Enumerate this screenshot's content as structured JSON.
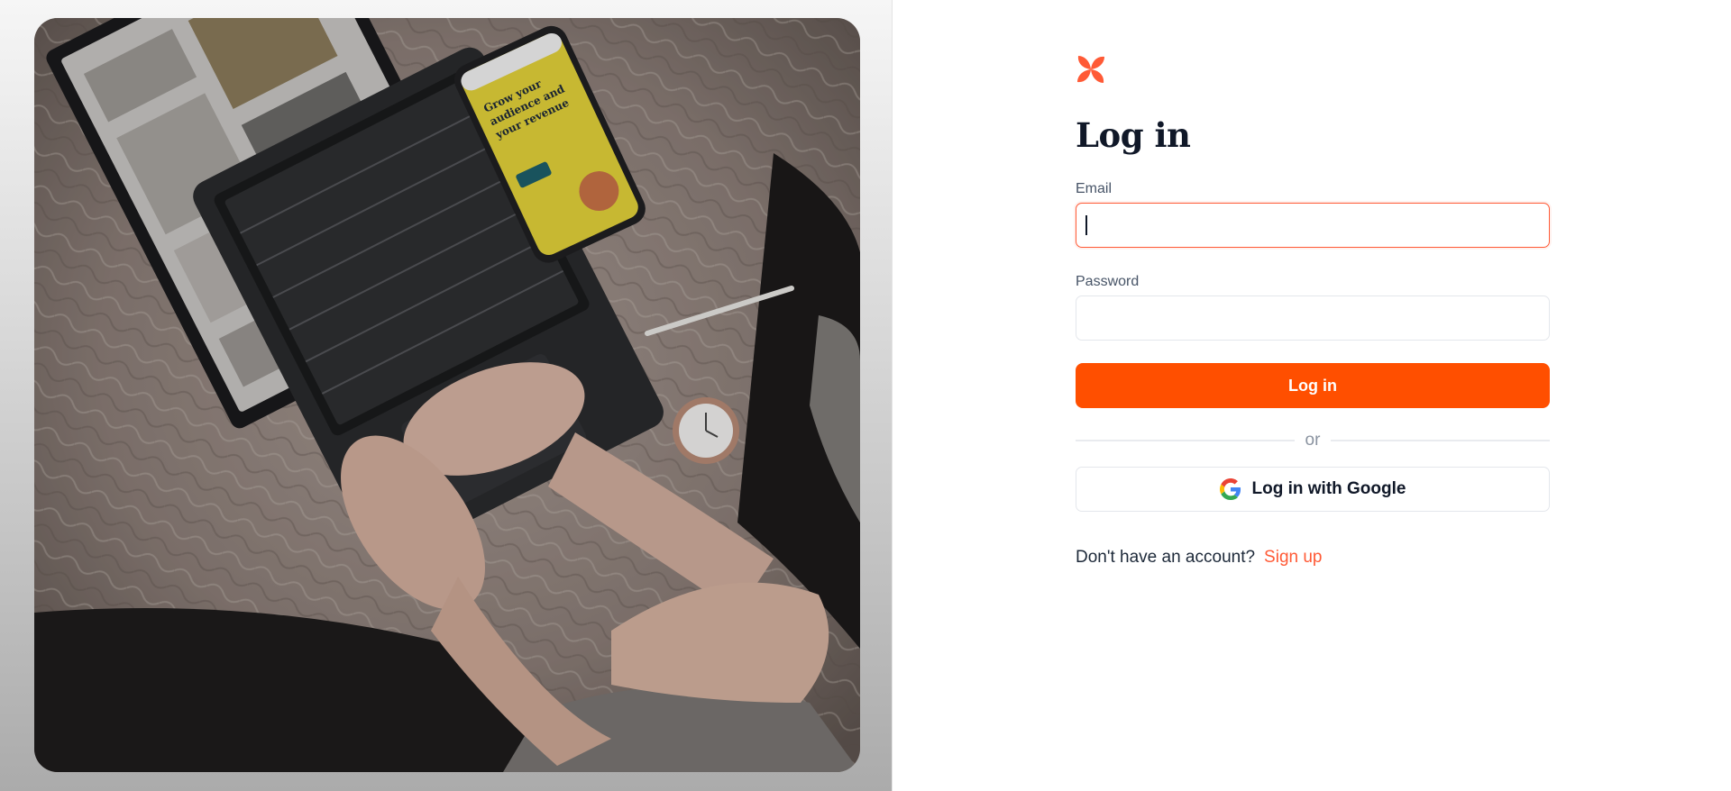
{
  "login": {
    "title": "Log in",
    "email_label": "Email",
    "email_value": "",
    "password_label": "Password",
    "password_value": "",
    "submit_label": "Log in",
    "divider_text": "or",
    "google_label": "Log in with Google",
    "signup_prompt": "Don't have an account?",
    "signup_link": "Sign up"
  },
  "hero_phone": {
    "headline": "Grow your audience and your revenue"
  },
  "colors": {
    "accent": "#ff4f00",
    "accent_light": "#ff5a36",
    "heading": "#101828",
    "muted": "#475467"
  },
  "icons": [
    "brand-logo-icon",
    "google-icon"
  ]
}
